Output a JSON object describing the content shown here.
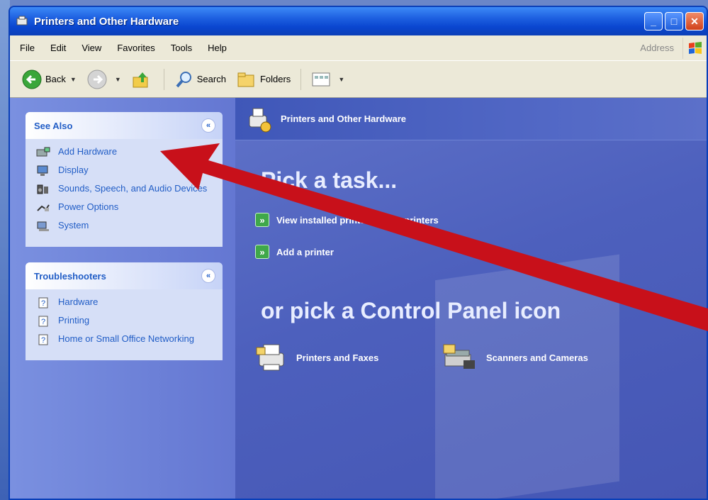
{
  "window": {
    "title": "Printers and Other Hardware",
    "controls": [
      "_",
      "□",
      "✕"
    ]
  },
  "menu": {
    "items": [
      "File",
      "Edit",
      "View",
      "Favorites",
      "Tools",
      "Help"
    ],
    "address_label": "Address"
  },
  "toolbar": {
    "back": "Back",
    "search": "Search",
    "folders": "Folders"
  },
  "see_also": {
    "title": "See Also",
    "items": [
      {
        "label": "Add Hardware",
        "icon": "add-hardware-icon"
      },
      {
        "label": "Display",
        "icon": "display-icon"
      },
      {
        "label": "Sounds, Speech, and Audio Devices",
        "icon": "sounds-icon"
      },
      {
        "label": "Power Options",
        "icon": "power-icon"
      },
      {
        "label": "System",
        "icon": "system-icon"
      }
    ]
  },
  "troubleshooters": {
    "title": "Troubleshooters",
    "items": [
      {
        "label": "Hardware",
        "icon": "help-icon"
      },
      {
        "label": "Printing",
        "icon": "help-icon"
      },
      {
        "label": "Home or Small Office Networking",
        "icon": "help-icon"
      }
    ]
  },
  "main": {
    "header": "Printers and Other Hardware",
    "pick_task": "Pick a task...",
    "tasks": [
      "View installed printers or fax printers",
      "Add a printer"
    ],
    "pick_icon": "or pick a Control Panel icon",
    "icons": [
      "Printers and Faxes",
      "Scanners and Cameras"
    ]
  },
  "colors": {
    "arrow": "#c8101a",
    "link": "#215dc6",
    "pane": "#4a5db8"
  }
}
